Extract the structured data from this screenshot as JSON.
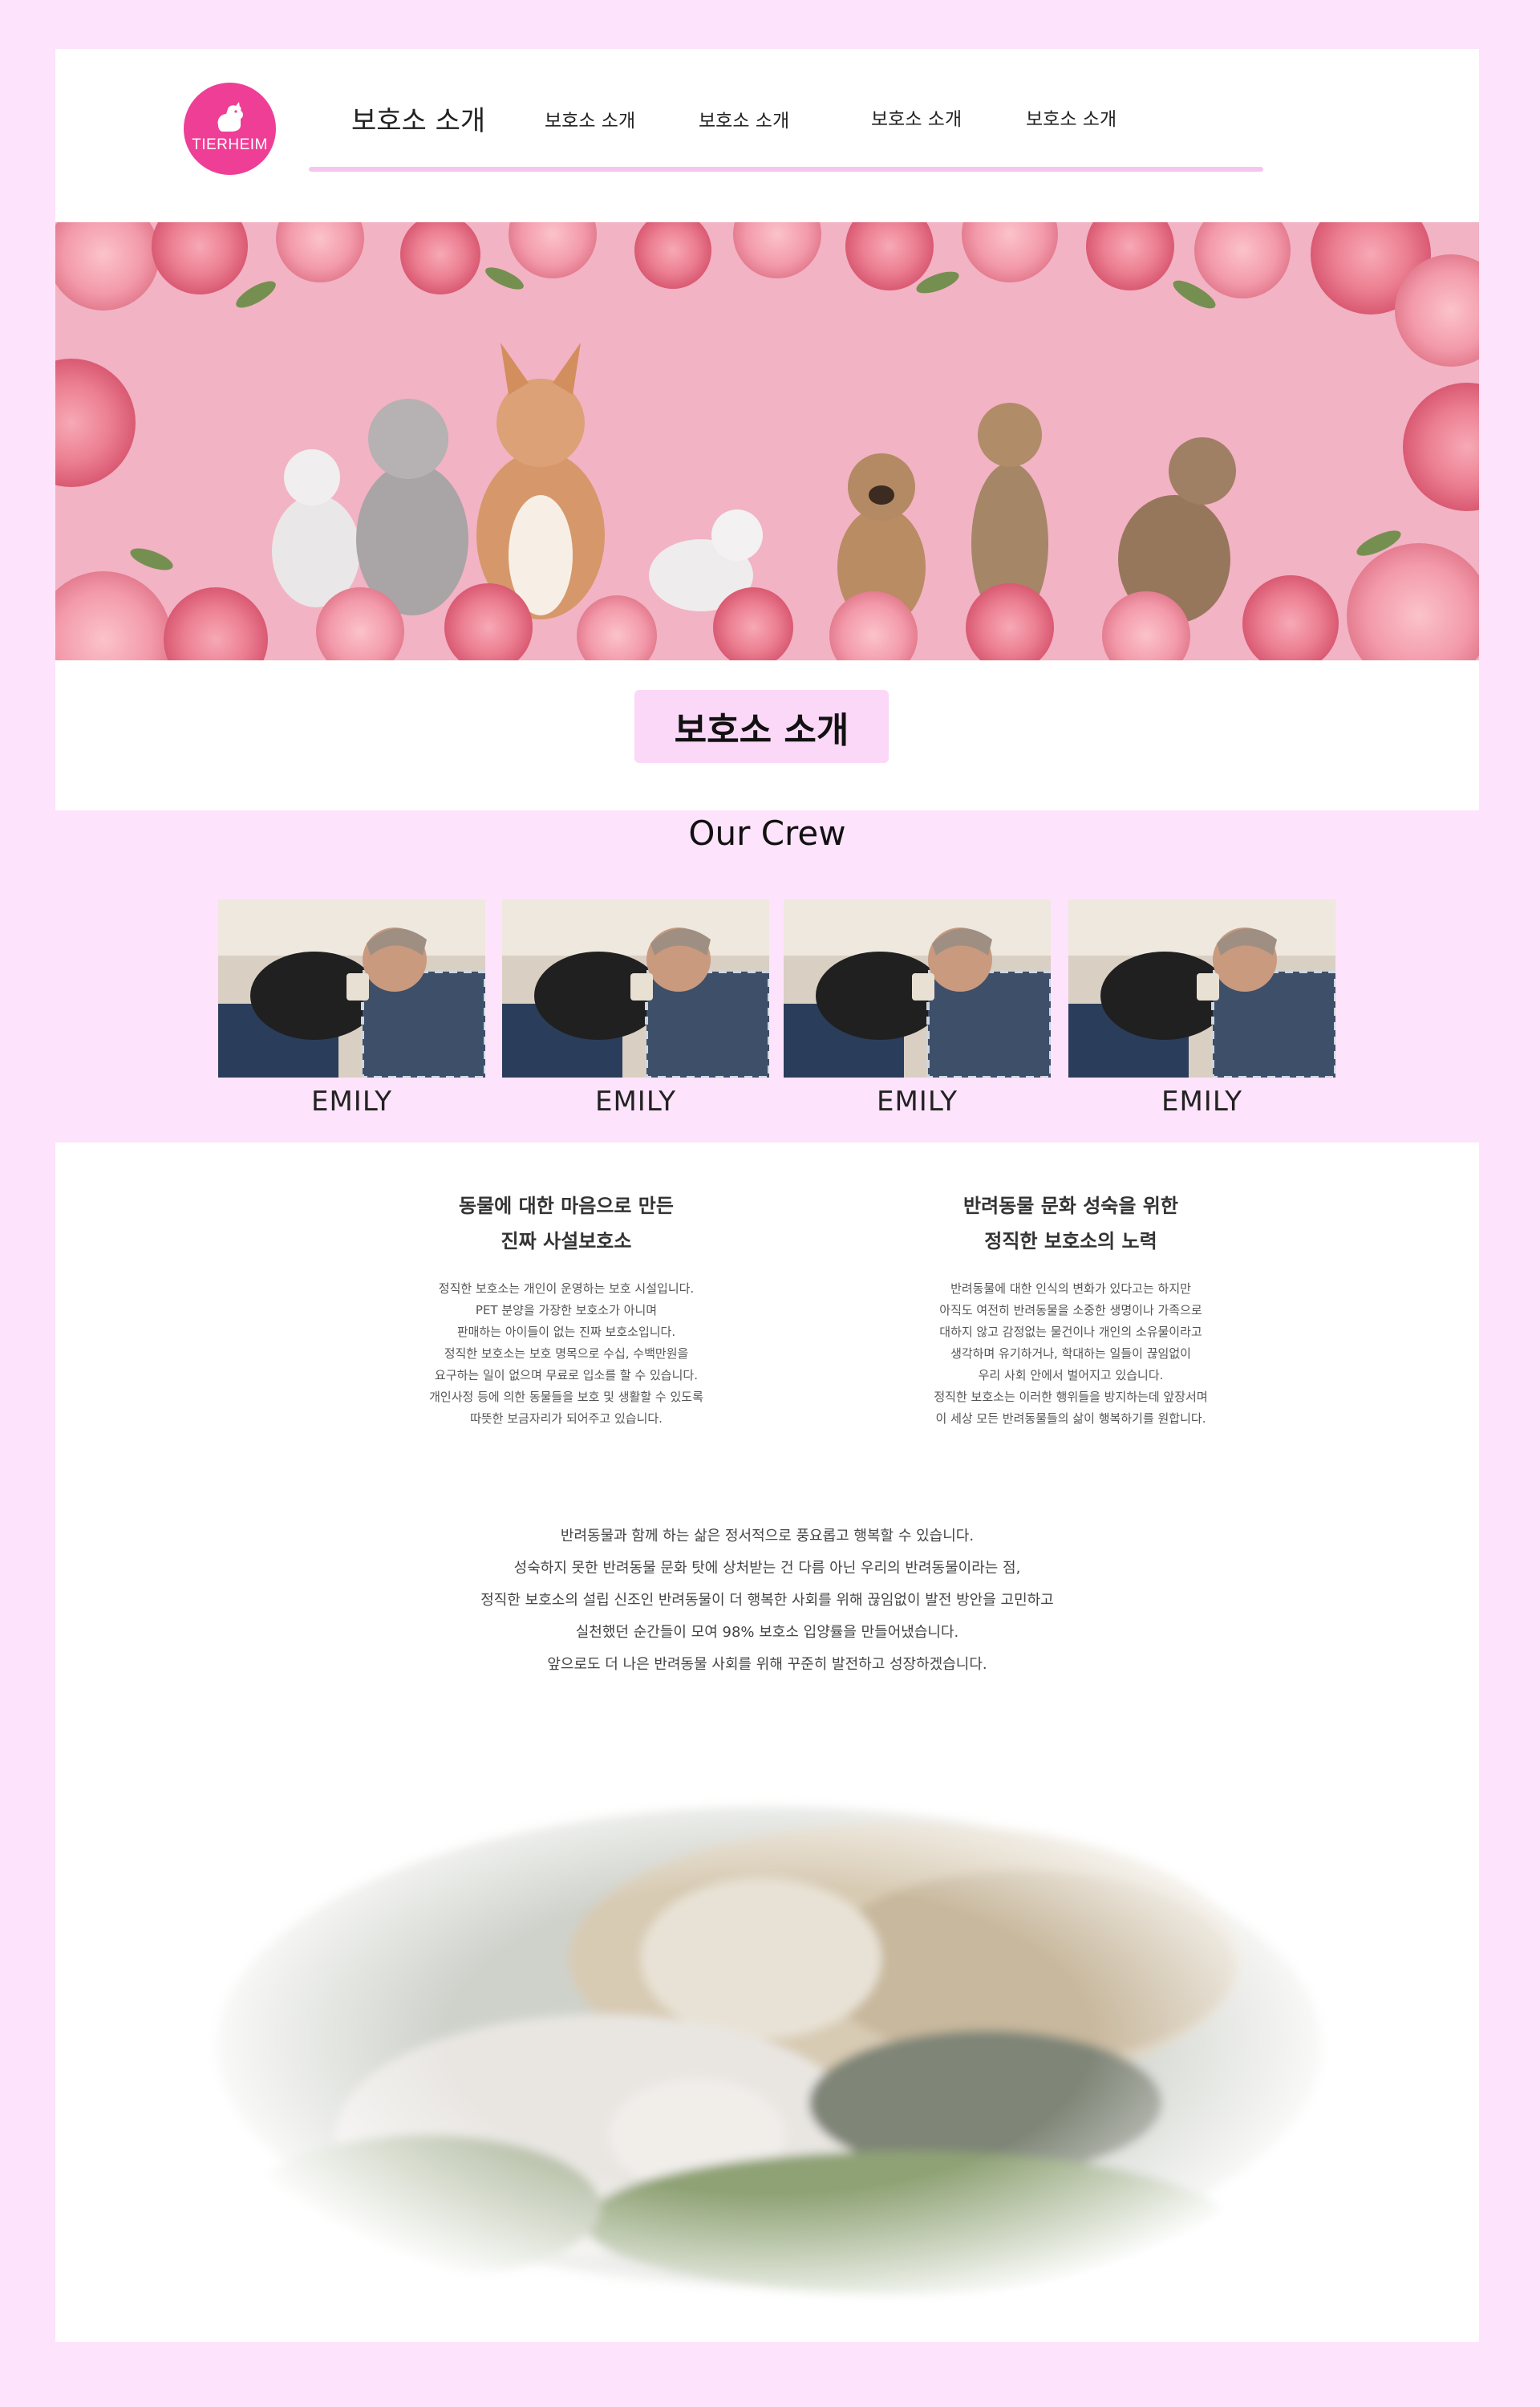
{
  "logo": {
    "text": "TIERHEIM",
    "brand_color": "#ef3e96"
  },
  "nav": {
    "items": [
      {
        "label": "보호소 소개"
      },
      {
        "label": "보호소 소개"
      },
      {
        "label": "보호소 소개"
      },
      {
        "label": "보호소 소개"
      },
      {
        "label": "보호소 소개"
      }
    ],
    "underline_color": "#f6c6ef"
  },
  "hero": {
    "image": "pink roses frame with cats and dogs",
    "background_color": "#f2b3c4"
  },
  "page_title": "보호소 소개",
  "crew": {
    "title": "Our Crew",
    "members": [
      {
        "name": "EMILY",
        "photo": "man with cat"
      },
      {
        "name": "EMILY",
        "photo": "man with cat"
      },
      {
        "name": "EMILY",
        "photo": "man with cat"
      },
      {
        "name": "EMILY",
        "photo": "man with cat"
      }
    ],
    "background_color": "#fde3fb"
  },
  "intro": {
    "left": {
      "heading": [
        "동물에 대한 마음으로 만든",
        "진짜 사설보호소"
      ],
      "body": [
        "정직한 보호소는 개인이 운영하는 보호 시설입니다.",
        "PET 분양을 가장한 보호소가 아니며",
        "판매하는 아이들이 없는 진짜 보호소입니다.",
        "정직한 보호소는 보호 명목으로 수십, 수백만원을",
        "요구하는 일이 없으며 무료로 입소를 할 수 있습니다.",
        "개인사정 등에 의한 동물들을 보호 및 생활할 수 있도록",
        "따뜻한 보금자리가 되어주고 있습니다."
      ]
    },
    "right": {
      "heading": [
        "반려동물 문화 성숙을 위한",
        "정직한 보호소의 노력"
      ],
      "body": [
        "반려동물에 대한 인식의 변화가 있다고는 하지만",
        "아직도 여전히 반려동물을 소중한 생명이나 가족으로",
        "대하지 않고 감정없는 물건이나 개인의 소유물이라고",
        "생각하며 유기하거나, 학대하는 일들이 끊임없이",
        "우리 사회 안에서 벌어지고 있습니다.",
        "정직한 보호소는 이러한 행위들을 방지하는데 앞장서며",
        "이 세상 모든 반려동물들의 삶이 행복하기를 원합니다."
      ]
    }
  },
  "story": [
    "반려동물과 함께 하는 삶은 정서적으로 풍요롭고 행복할 수 있습니다.",
    "성숙하지 못한 반려동물 문화 탓에 상처받는 건 다름 아닌 우리의 반려동물이라는 점,",
    "정직한 보호소의 설립 신조인 반려동물이 더 행복한 사회를 위해 끊임없이 발전 방안을 고민하고",
    "실천했던 순간들이 모여 98% 보호소 입양률을 만들어냈습니다.",
    "앞으로도 더 나은 반려동물 사회를 위해 꾸준히 발전하고 성장하겠습니다."
  ],
  "bottom_image": "cat and dog sleeping together"
}
